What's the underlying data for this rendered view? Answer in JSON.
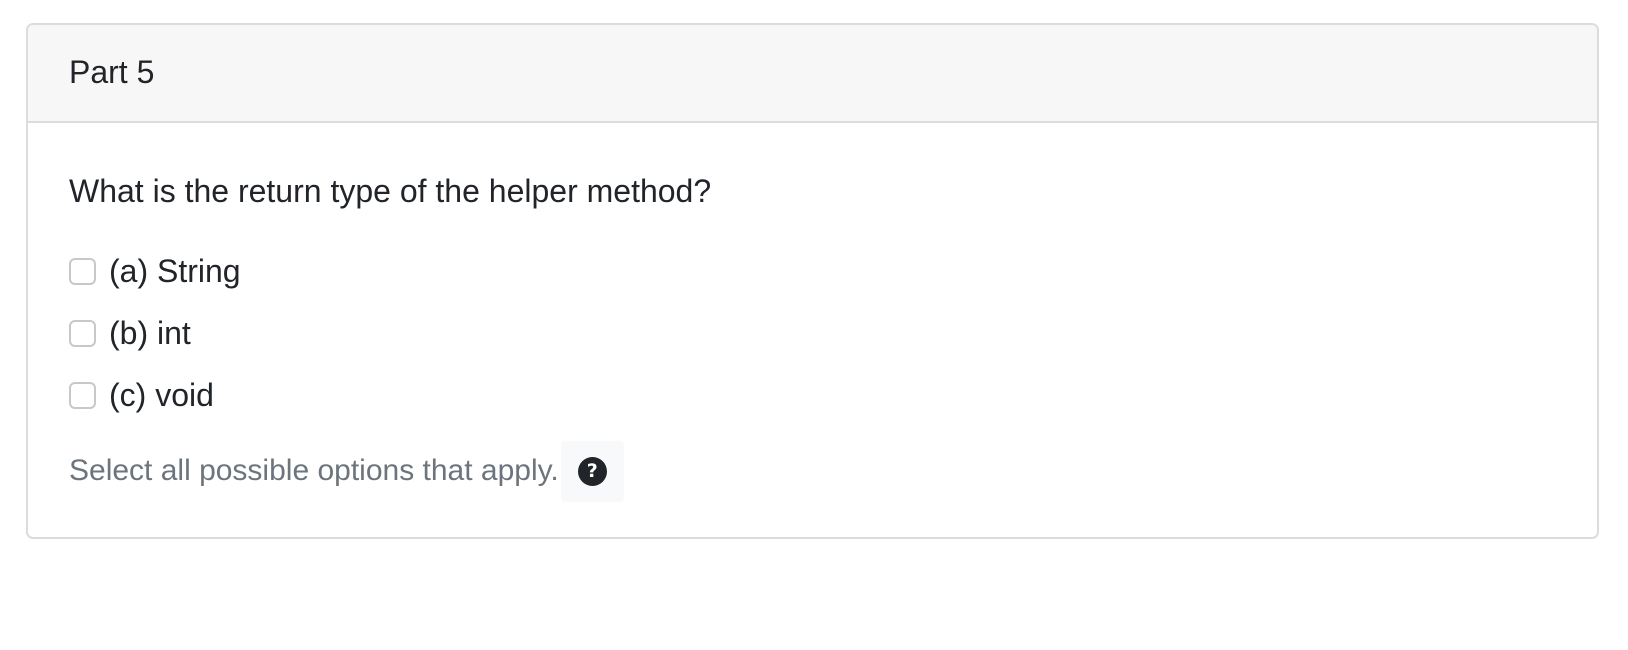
{
  "card": {
    "title": "Part 5",
    "question": "What is the return type of the helper method?",
    "options": [
      {
        "label": "(a) String",
        "checked": false
      },
      {
        "label": "(b) int",
        "checked": false
      },
      {
        "label": "(c) void",
        "checked": false
      }
    ],
    "hint": "Select all possible options that apply.",
    "help_icon": {
      "name": "question-mark-icon",
      "glyph": "?"
    }
  }
}
